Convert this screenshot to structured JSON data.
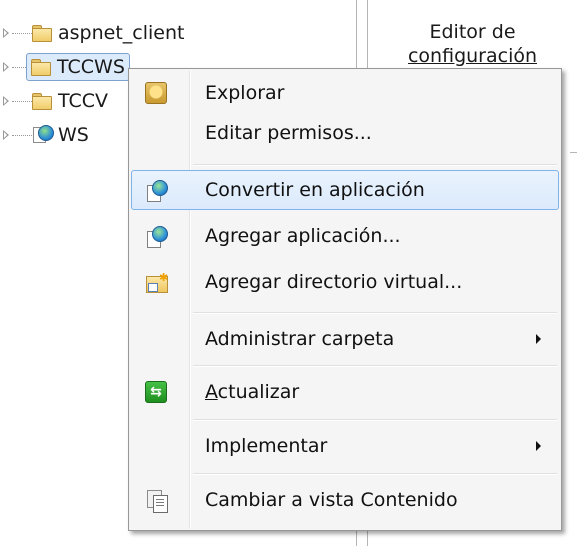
{
  "tree": {
    "items": [
      {
        "label": "aspnet_client",
        "icon": "folder-icon"
      },
      {
        "label": "TCCWS",
        "icon": "folder-icon",
        "selected": true
      },
      {
        "label": "TCCV",
        "icon": "folder-icon"
      },
      {
        "label": "WS",
        "icon": "web-app-globe-icon"
      }
    ]
  },
  "right_pane": {
    "title_line1": "Editor de",
    "title_line2": "configuración"
  },
  "context_menu": {
    "items": [
      {
        "label": "Explorar",
        "icon": "explore-icon"
      },
      {
        "label": "Editar permisos..."
      },
      {
        "label": "Convertir en aplicación",
        "icon": "application-icon",
        "highlighted": true
      },
      {
        "label": "Agregar aplicación...",
        "icon": "application-icon"
      },
      {
        "label": "Agregar directorio virtual...",
        "icon": "virtual-directory-icon"
      },
      {
        "label": "Administrar carpeta",
        "submenu": true
      },
      {
        "label_mnemonic": "A",
        "label_rest": "ctualizar",
        "icon": "refresh-icon"
      },
      {
        "label": "Implementar",
        "submenu": true
      },
      {
        "label": "Cambiar a vista Contenido",
        "icon": "content-view-icon"
      }
    ]
  },
  "colors": {
    "highlight_border": "#7eb4ea",
    "highlight_fill": "#dbeafc",
    "tree_selection_border": "#7da2ce"
  }
}
